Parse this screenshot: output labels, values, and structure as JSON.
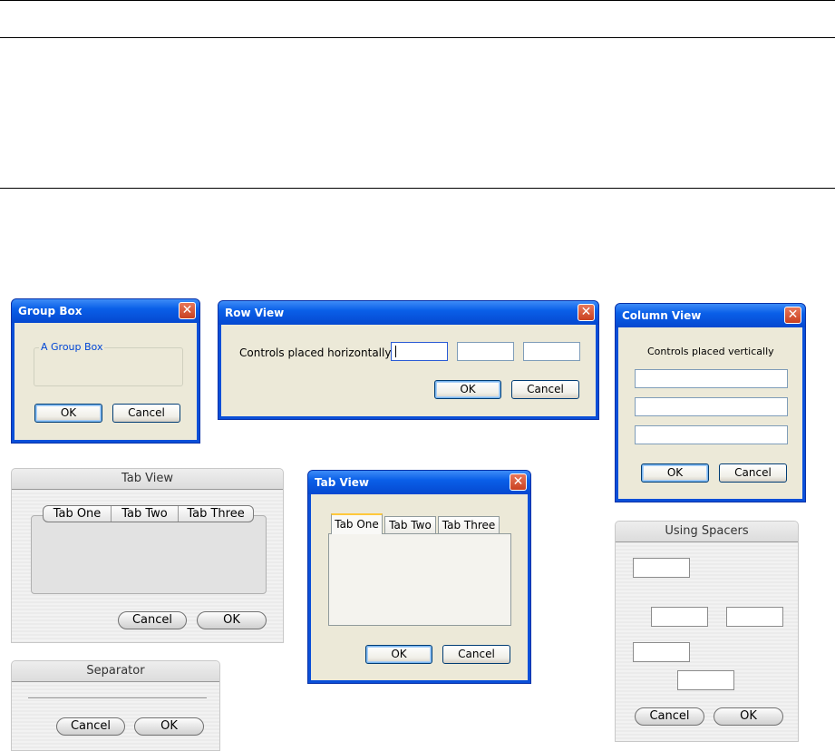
{
  "group_box_dialog": {
    "title": "Group Box",
    "close": "✕",
    "group_label": "A Group Box",
    "ok": "OK",
    "cancel": "Cancel"
  },
  "row_view_dialog": {
    "title": "Row View",
    "close": "✕",
    "label": "Controls placed horizontally",
    "ok": "OK",
    "cancel": "Cancel"
  },
  "column_view_dialog": {
    "title": "Column View",
    "close": "✕",
    "label": "Controls placed vertically",
    "ok": "OK",
    "cancel": "Cancel"
  },
  "mac_tab_view": {
    "title": "Tab View",
    "tabs": [
      "Tab One",
      "Tab Two",
      "Tab Three"
    ],
    "cancel": "Cancel",
    "ok": "OK"
  },
  "xp_tab_view": {
    "title": "Tab View",
    "close": "✕",
    "tabs": [
      "Tab One",
      "Tab Two",
      "Tab Three"
    ],
    "ok": "OK",
    "cancel": "Cancel"
  },
  "separator_window": {
    "title": "Separator",
    "cancel": "Cancel",
    "ok": "OK"
  },
  "spacers_window": {
    "title": "Using Spacers",
    "cancel": "Cancel",
    "ok": "OK"
  }
}
